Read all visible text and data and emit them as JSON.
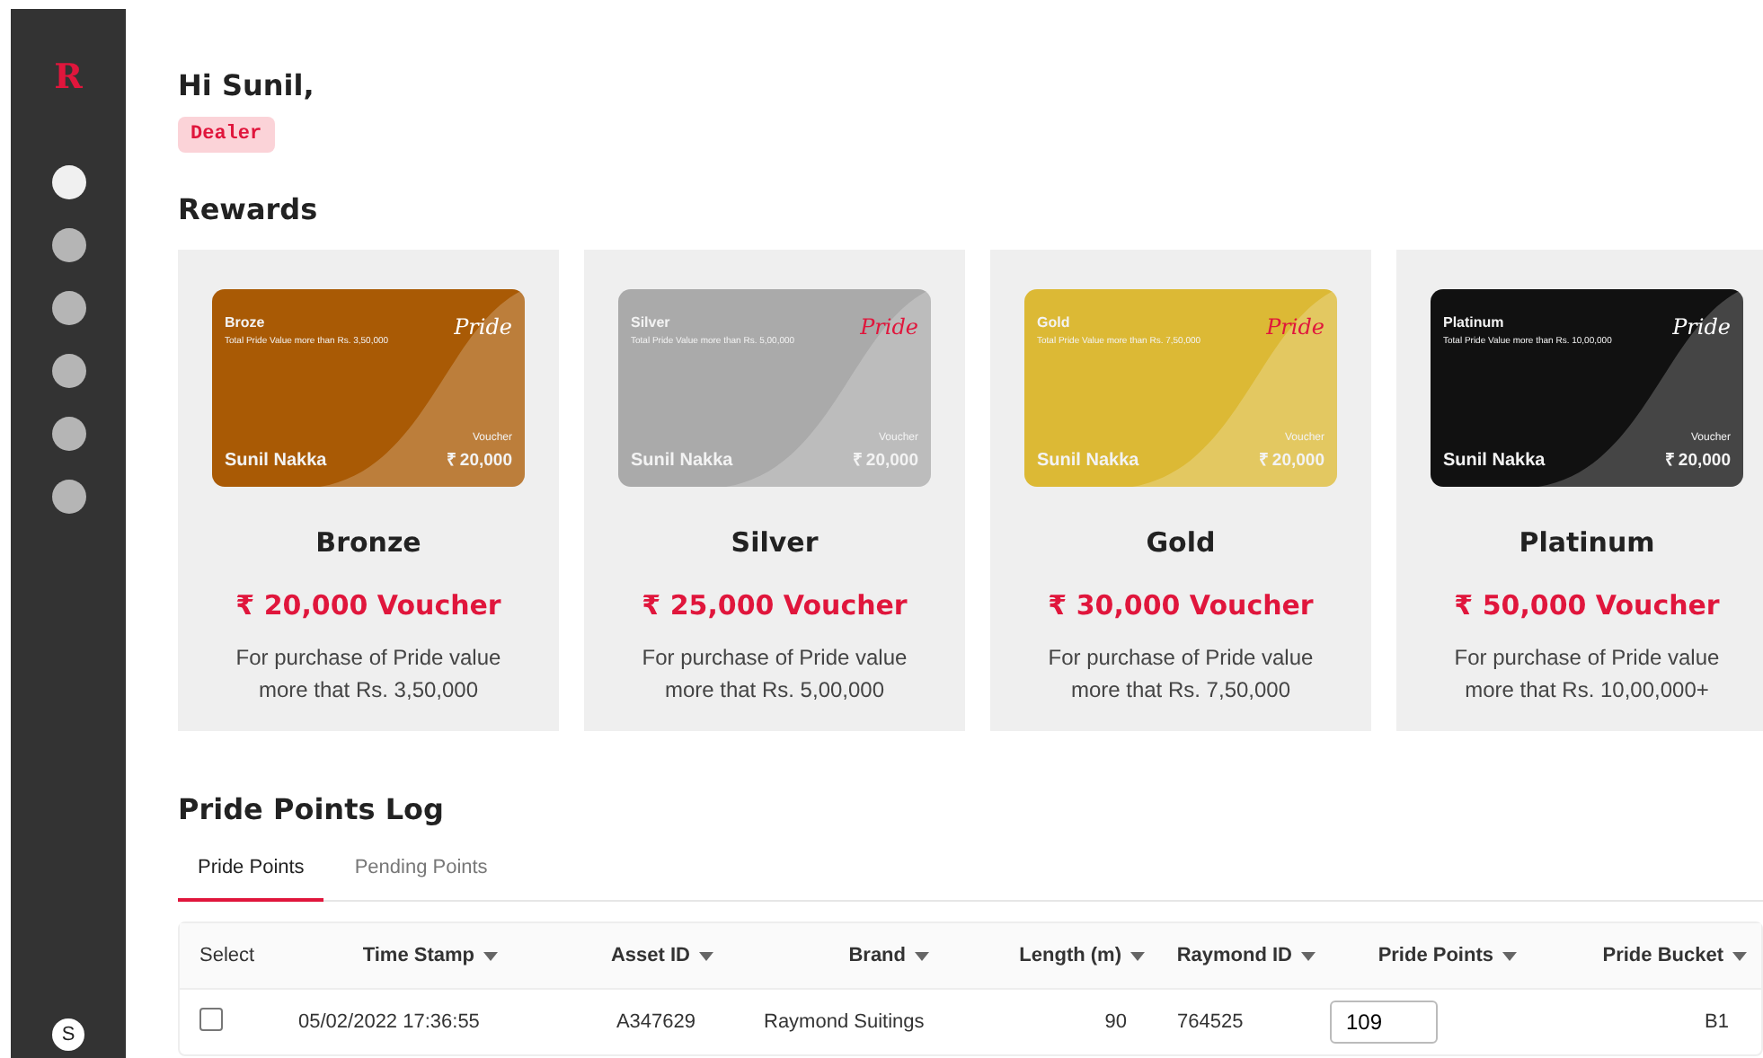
{
  "sidebar": {
    "logo": "R",
    "items": [
      {
        "selected": true
      },
      {
        "selected": false
      },
      {
        "selected": false
      },
      {
        "selected": false
      },
      {
        "selected": false
      },
      {
        "selected": false
      }
    ],
    "avatar": "S"
  },
  "greeting": "Hi Sunil,",
  "role_badge": "Dealer",
  "rewards": {
    "title": "Rewards",
    "items": [
      {
        "kind": "bronze",
        "card_tier": "Broze",
        "card_subtitle": "Total Pride Value more than Rs. 3,50,000",
        "logo": "Pride",
        "holder": "Sunil Nakka",
        "voucher_label": "Voucher",
        "card_amount": "₹ 20,000",
        "name": "Bronze",
        "voucher": "₹ 20,000 Voucher",
        "description": "For purchase of Pride value more that Rs. 3,50,000"
      },
      {
        "kind": "silver",
        "card_tier": "Silver",
        "card_subtitle": "Total Pride Value more than Rs. 5,00,000",
        "logo": "Pride",
        "holder": "Sunil Nakka",
        "voucher_label": "Voucher",
        "card_amount": "₹ 20,000",
        "name": "Silver",
        "voucher": "₹ 25,000 Voucher",
        "description": "For purchase of Pride value more that Rs. 5,00,000"
      },
      {
        "kind": "gold",
        "card_tier": "Gold",
        "card_subtitle": "Total Pride Value more than Rs. 7,50,000",
        "logo": "Pride",
        "holder": "Sunil Nakka",
        "voucher_label": "Voucher",
        "card_amount": "₹ 20,000",
        "name": "Gold",
        "voucher": "₹ 30,000 Voucher",
        "description": "For purchase of Pride value more that Rs. 7,50,000"
      },
      {
        "kind": "platinum",
        "card_tier": "Platinum",
        "card_subtitle": "Total Pride Value more than Rs. 10,00,000",
        "logo": "Pride",
        "holder": "Sunil Nakka",
        "voucher_label": "Voucher",
        "card_amount": "₹ 20,000",
        "name": "Platinum",
        "voucher": "₹ 50,000 Voucher",
        "description": "For purchase of Pride value more that Rs. 10,00,000+"
      }
    ]
  },
  "log": {
    "title": "Pride Points Log",
    "tabs": [
      {
        "label": "Pride Points",
        "selected": true
      },
      {
        "label": "Pending Points",
        "selected": false
      }
    ],
    "table": {
      "columns": [
        {
          "label": "Select",
          "sortable": false
        },
        {
          "label": "Time Stamp",
          "sortable": true
        },
        {
          "label": "Asset ID",
          "sortable": true
        },
        {
          "label": "Brand",
          "sortable": true
        },
        {
          "label": "Length (m)",
          "sortable": true
        },
        {
          "label": "Raymond ID",
          "sortable": true
        },
        {
          "label": "Pride Points",
          "sortable": true
        },
        {
          "label": "Pride Bucket",
          "sortable": true
        }
      ],
      "rows": [
        {
          "checked": false,
          "time_stamp": "05/02/2022 17:36:55",
          "asset_id": "A347629",
          "brand": "Raymond Suitings",
          "length": "90",
          "raymond_id": "764525",
          "pride_points": "109",
          "pride_bucket": "B1"
        }
      ]
    }
  }
}
